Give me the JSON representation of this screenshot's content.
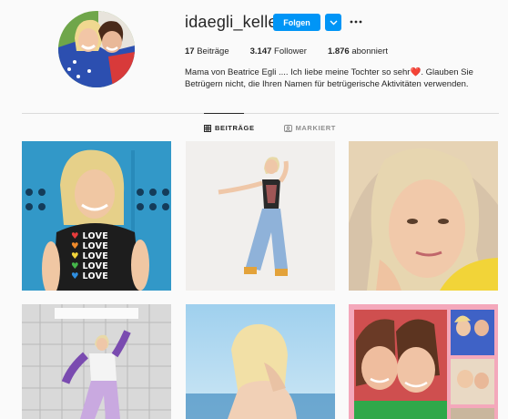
{
  "profile": {
    "username": "idaegli_keller",
    "follow_label": "Folgen",
    "stats": {
      "posts_count": "17",
      "posts_label": "Beiträge",
      "followers_count": "3.147",
      "followers_label": "Follower",
      "following_count": "1.876",
      "following_label": "abonniert"
    },
    "bio_part1": "Mama von Beatrice Egli .... Ich liebe meine Tochter so sehr",
    "bio_heart": "❤️",
    "bio_part2": ". Glauben Sie Betrügern nicht, die Ihren Namen für betrügerische Aktivitäten verwenden."
  },
  "tabs": [
    {
      "label": "BEITRÄGE",
      "icon": "grid-icon",
      "active": true
    },
    {
      "label": "MARKIERT",
      "icon": "tag-icon",
      "active": false
    }
  ],
  "posts": [
    {
      "name": "post-1",
      "shirt_lines": [
        "LOVE",
        "LOVE",
        "LOVE",
        "LOVE",
        "LOVE"
      ]
    },
    {
      "name": "post-2"
    },
    {
      "name": "post-3"
    },
    {
      "name": "post-4"
    },
    {
      "name": "post-5"
    },
    {
      "name": "post-6"
    }
  ],
  "colors": {
    "accent": "#0095f6",
    "background": "#fafafa",
    "text": "#262626",
    "muted": "#8e8e8e",
    "border": "#dbdbdb"
  }
}
